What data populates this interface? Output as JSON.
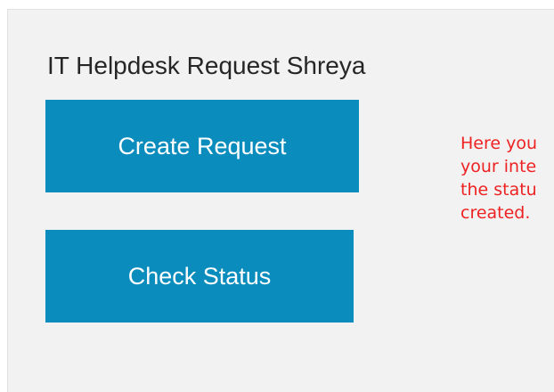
{
  "page": {
    "title": "IT Helpdesk Request Shreya"
  },
  "actions": {
    "create_label": "Create Request",
    "status_label": "Check Status"
  },
  "help_text": {
    "lines": [
      "Here you",
      "your inte",
      "the statu",
      "created."
    ]
  },
  "colors": {
    "panel_background": "#f2f2f2",
    "button_background": "#0a8cbd",
    "button_text": "#ffffff",
    "help_text": "#ee2222",
    "title_text": "#262626"
  }
}
